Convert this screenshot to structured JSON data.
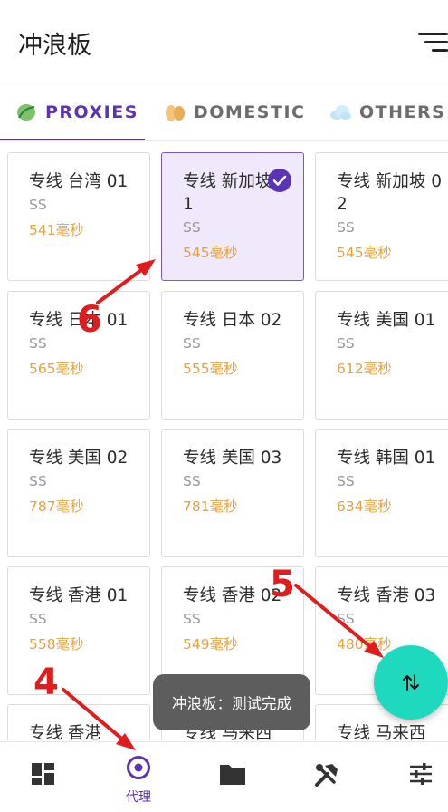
{
  "app": {
    "title": "冲浪板"
  },
  "tabs": [
    {
      "label": "PROXIES",
      "icon": "leaf-icon",
      "active": true
    },
    {
      "label": "DOMESTIC",
      "icon": "peanut-icon",
      "active": false
    },
    {
      "label": "OTHERS",
      "icon": "cloud-icon",
      "active": false
    }
  ],
  "proxies": [
    {
      "name": "专线 台湾 01",
      "type": "SS",
      "latency": "541毫秒"
    },
    {
      "name": "专线 新加坡 01",
      "type": "SS",
      "latency": "545毫秒",
      "selected": true
    },
    {
      "name": "专线 新加坡 02",
      "type": "SS",
      "latency": "545毫秒"
    },
    {
      "name": "专线 日本 01",
      "type": "SS",
      "latency": "565毫秒"
    },
    {
      "name": "专线 日本 02",
      "type": "SS",
      "latency": "555毫秒"
    },
    {
      "name": "专线 美国 01",
      "type": "SS",
      "latency": "612毫秒"
    },
    {
      "name": "专线 美国 02",
      "type": "SS",
      "latency": "787毫秒"
    },
    {
      "name": "专线 美国 03",
      "type": "SS",
      "latency": "781毫秒"
    },
    {
      "name": "专线 韩国 01",
      "type": "SS",
      "latency": "634毫秒"
    },
    {
      "name": "专线 香港 01",
      "type": "SS",
      "latency": "558毫秒"
    },
    {
      "name": "专线 香港 02",
      "type": "SS",
      "latency": "549毫秒"
    },
    {
      "name": "专线 香港 03",
      "type": "SS",
      "latency": "480毫秒"
    },
    {
      "name": "专线 香港",
      "type": "",
      "latency": ""
    },
    {
      "name": "专线 马来西",
      "type": "",
      "latency": ""
    },
    {
      "name": "专线 马来西",
      "type": "",
      "latency": ""
    }
  ],
  "toast": {
    "text": "冲浪板：测试完成"
  },
  "fab": {
    "icon": "swap-vertical-icon"
  },
  "nav": [
    {
      "id": "dashboard",
      "icon": "dashboard-icon",
      "label": ""
    },
    {
      "id": "proxy",
      "icon": "target-icon",
      "label": "代理",
      "active": true
    },
    {
      "id": "profiles",
      "icon": "folder-icon",
      "label": ""
    },
    {
      "id": "tools",
      "icon": "tools-icon",
      "label": ""
    },
    {
      "id": "settings",
      "icon": "sliders-icon",
      "label": ""
    }
  ],
  "annotations": [
    {
      "label": "6"
    },
    {
      "label": "5"
    },
    {
      "label": "4"
    }
  ],
  "colors": {
    "accent": "#5b34b5",
    "latency": "#e6a23c",
    "fab": "#1fd9bf",
    "annotation": "#e01c1c"
  }
}
